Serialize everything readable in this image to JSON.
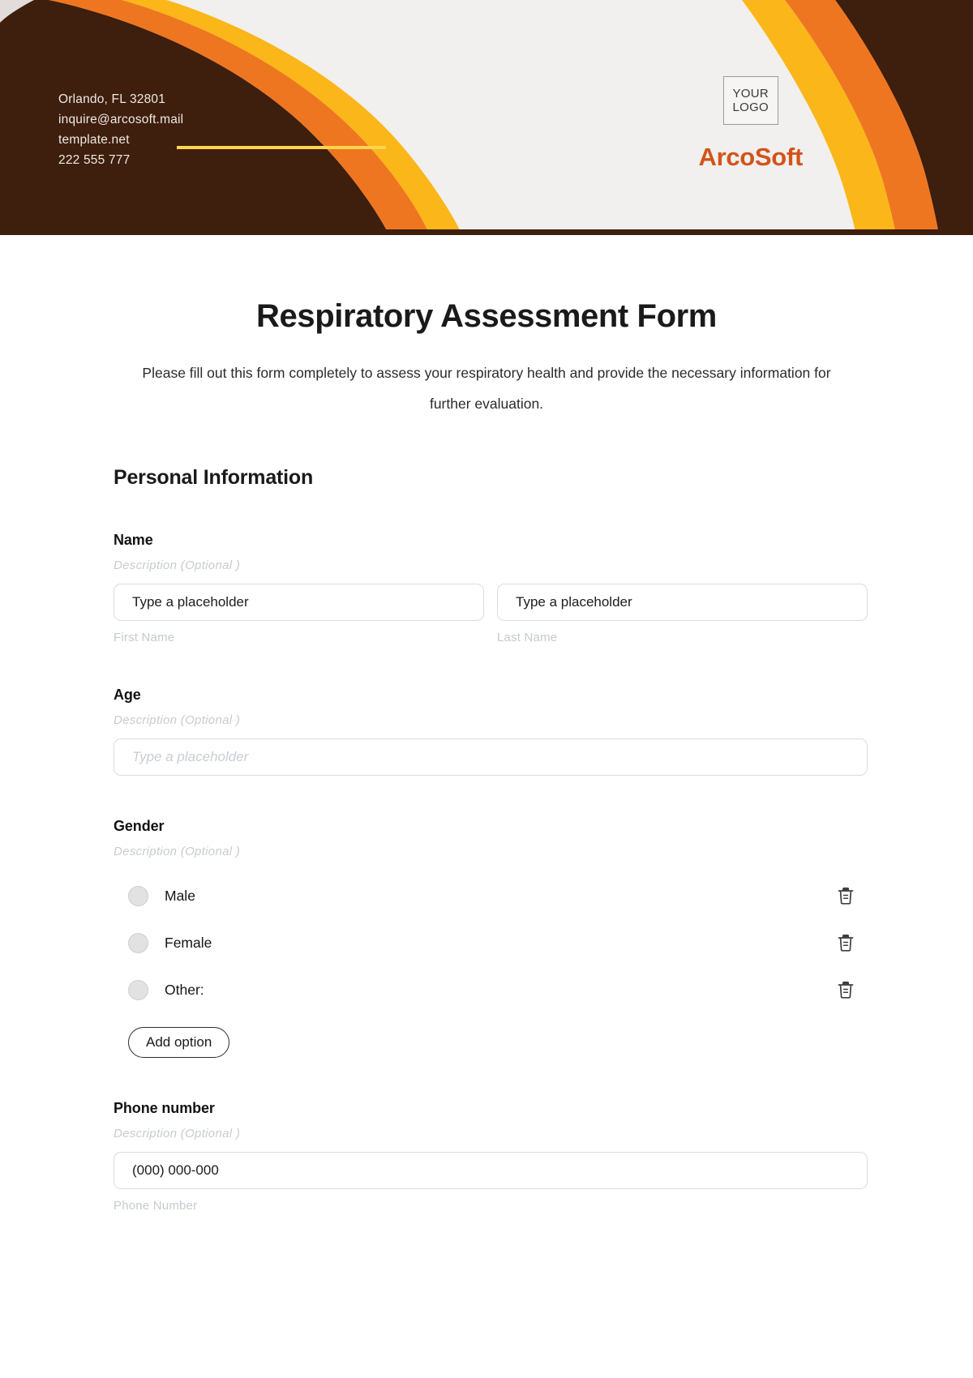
{
  "header": {
    "contact": [
      "Orlando, FL 32801",
      "inquire@arcosoft.mail",
      "template.net",
      "222 555 777"
    ],
    "logo_line1": "YOUR",
    "logo_line2": "LOGO",
    "brand": "ArcoSoft",
    "colors": {
      "dark_brown": "#3e1e0d",
      "orange": "#ef7620",
      "yellow": "#fbb619",
      "light_yellow": "#fdd44f",
      "banner_bg": "#f1f0ee",
      "brand_orange": "#d2541a"
    }
  },
  "form": {
    "title": "Respiratory Assessment Form",
    "subtitle": "Please fill out this form completely to assess your respiratory health and provide the necessary information for further evaluation.",
    "section_title": "Personal Information",
    "description_placeholder": "Description  (Optional )",
    "fields": {
      "name": {
        "label": "Name",
        "description": "Description  (Optional )",
        "first_value": "Type a placeholder",
        "last_value": "Type a placeholder",
        "first_sublabel": "First Name",
        "last_sublabel": "Last Name"
      },
      "age": {
        "label": "Age",
        "description": "Description  (Optional )",
        "placeholder": "Type a placeholder"
      },
      "gender": {
        "label": "Gender",
        "description": "Description  (Optional )",
        "options": [
          {
            "label": "Male"
          },
          {
            "label": "Female"
          },
          {
            "label": "Other:"
          }
        ],
        "add_option_label": "Add option",
        "delete_icon": "trash-icon"
      },
      "phone": {
        "label": "Phone number",
        "description": "Description  (Optional )",
        "value": "(000) 000-000",
        "sublabel": "Phone Number"
      }
    }
  }
}
